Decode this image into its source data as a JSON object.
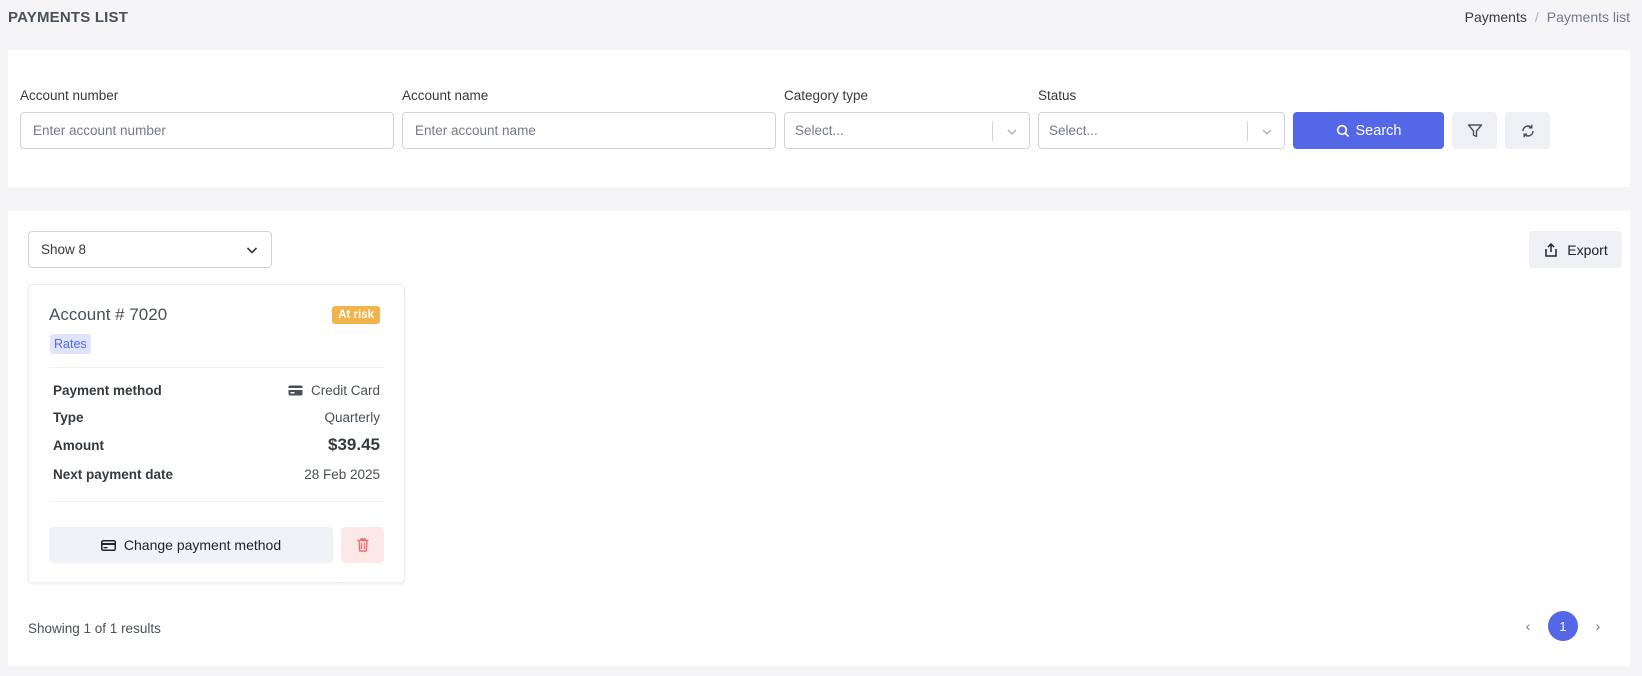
{
  "header": {
    "title": "PAYMENTS LIST",
    "breadcrumb": [
      "Payments",
      "Payments list"
    ],
    "breadcrumb_sep": "/"
  },
  "filters": {
    "account_number": {
      "label": "Account number",
      "placeholder": "Enter account number"
    },
    "account_name": {
      "label": "Account name",
      "placeholder": "Enter account name"
    },
    "category_type": {
      "label": "Category type",
      "value": "Select..."
    },
    "status": {
      "label": "Status",
      "value": "Select..."
    },
    "search_label": "Search"
  },
  "list": {
    "page_size_label": "Show 8",
    "export_label": "Export",
    "cards": [
      {
        "account_prefix": "Account #",
        "account_number": "7020",
        "status_badge": "At risk",
        "category_badge": "Rates",
        "payment_method_label": "Payment method",
        "payment_method_value": "Credit Card",
        "type_label": "Type",
        "type_value": "Quarterly",
        "amount_label": "Amount",
        "amount_value": "$39.45",
        "next_date_label": "Next payment date",
        "next_date_value": "28 Feb 2025",
        "change_method_label": "Change payment method"
      }
    ],
    "results_text": "Showing 1 of 1 results",
    "pagination": {
      "prev": "‹",
      "current": "1",
      "next": "›"
    }
  },
  "colors": {
    "primary": "#5468e7",
    "warning": "#f1b44c",
    "danger": "#f46a6a"
  }
}
